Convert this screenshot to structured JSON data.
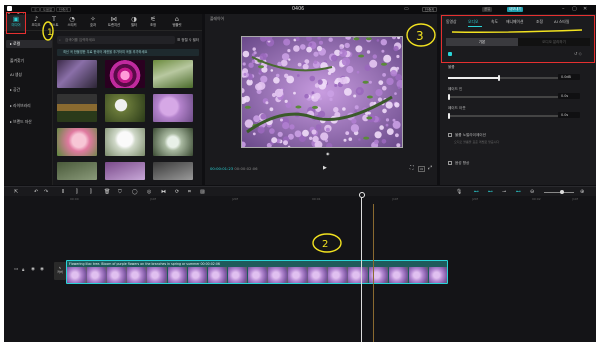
{
  "window": {
    "app_name": "CapCut",
    "project_title": "0406",
    "edition_chip": "Ⓒ",
    "left_chips": [
      "도움말",
      "단축키"
    ],
    "right_buttons": [
      "단축키",
      "공유",
      "내보내기"
    ]
  },
  "media_toolbar": {
    "tools": [
      {
        "label": "미디어",
        "icon": "media-icon"
      },
      {
        "label": "오디오",
        "icon": "audio-icon"
      },
      {
        "label": "텍스트",
        "icon": "text-icon"
      },
      {
        "label": "스티커",
        "icon": "sticker-icon"
      },
      {
        "label": "효과",
        "icon": "effects-icon"
      },
      {
        "label": "트랜지션",
        "icon": "transitions-icon"
      },
      {
        "label": "필터",
        "icon": "filters-icon"
      },
      {
        "label": "조정",
        "icon": "adjust-icon"
      },
      {
        "label": "템플릿",
        "icon": "templates-icon"
      }
    ]
  },
  "nav": {
    "items": [
      "▸ 로컬",
      "즐겨찾기",
      "AI 생성",
      "▸ 공간",
      "▸ 라이브러리",
      "▸ 브랜드 자산"
    ]
  },
  "library": {
    "search_placeholder": "검색어를 입력하세요",
    "filter_labels": [
      "☰ 정렬",
      "⚲ 필터"
    ],
    "notice": "최신 곡 한불영한 무료 한국어 제한을 추가하여 곡을 추가하세요"
  },
  "player": {
    "title": "플레이어",
    "time_current": "00:00:01:23",
    "time_total": "00:00:02:06"
  },
  "inspector": {
    "tabs": [
      "동영상",
      "오디오",
      "속도",
      "애니메이션",
      "조정",
      "AI 스타일"
    ],
    "subtabs": [
      "기본",
      "오디오 분리하기"
    ],
    "properties": [
      {
        "label": "볼륨",
        "value": "0.0dB",
        "level": 0.5
      },
      {
        "label": "페이드 인",
        "value": "0.0s",
        "level": 0.0
      },
      {
        "label": "페이드 아웃",
        "value": "0.0s",
        "level": 0.0
      }
    ],
    "toggles": [
      "볼륨 노멀라이제이션",
      "음성 향상"
    ],
    "toggle_note": "오디오 볼륨을 표준 레벨로 맞춥니다"
  },
  "timeline": {
    "ruler_ticks": [
      "00:00",
      "|10f",
      "|20f",
      "00:01",
      "|10f",
      "|20f",
      "00:02",
      "|10f"
    ],
    "clip_label": "Flowering lilac tree. Bloom of purple flowers on the branches in spring or summer  00:00:02:06",
    "cover_label": "커버"
  },
  "annotations": {
    "note_1": "1",
    "note_2": "2",
    "note_3": "3"
  },
  "colors": {
    "accent": "#2ad4d8",
    "annotation_red": "#e53030",
    "annotation_yellow": "#f2e220"
  }
}
